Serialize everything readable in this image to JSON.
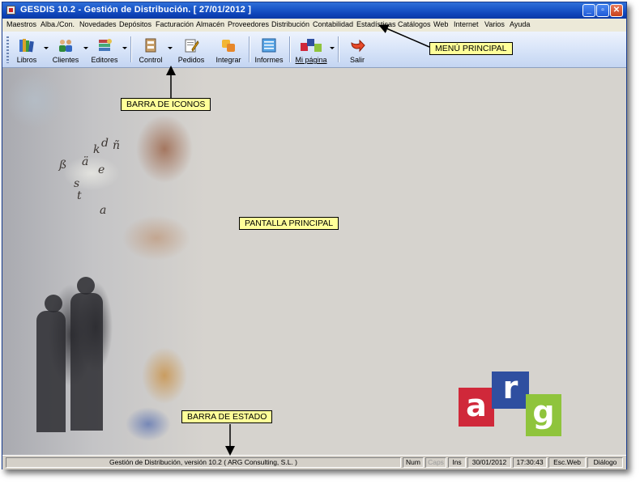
{
  "window": {
    "title": "GESDIS 10.2 - Gestión de Distribución. [ 27/01/2012 ]",
    "minimize": "_",
    "maximize": "▫",
    "close": "✕"
  },
  "menu": [
    "Maestros",
    "Alba./Con.",
    "Novedades",
    "Depósitos",
    "Facturación",
    "Almacén",
    "Proveedores",
    "Distribución",
    "Contabilidad",
    "Estadísticas",
    "Catálogos",
    "Web",
    "Internet",
    "Varios",
    "Ayuda"
  ],
  "toolbar": {
    "libros": "Libros",
    "clientes": "Clientes",
    "editores": "Editores",
    "control": "Control",
    "pedidos": "Pedidos",
    "integrar": "Integrar",
    "informes": "Informes",
    "mi_pagina": "Mi página",
    "salir": "Salir"
  },
  "callouts": {
    "menu_principal": "MENÚ PRINCIPAL",
    "barra_iconos": "BARRA DE ICONOS",
    "pantalla_principal": "PANTALLA PRINCIPAL",
    "barra_estado": "BARRA DE ESTADO"
  },
  "background_letters": [
    "k",
    "d",
    "ñ",
    "ä",
    "ß",
    "e",
    "s",
    "t",
    "a"
  ],
  "logo": {
    "a": "a",
    "r": "r",
    "g": "g",
    "colors": {
      "a": "#d0283a",
      "r": "#2f4fa0",
      "g": "#8fc43c"
    }
  },
  "statusbar": {
    "message": "Gestión de Distribución, versión 10.2 ( ARG Consulting, S.L. )",
    "num": "Num",
    "caps": "Caps",
    "ins": "Ins",
    "date": "30/01/2012",
    "time": "17:30:43",
    "esc": "Esc.Web",
    "dialog": "Diálogo"
  }
}
